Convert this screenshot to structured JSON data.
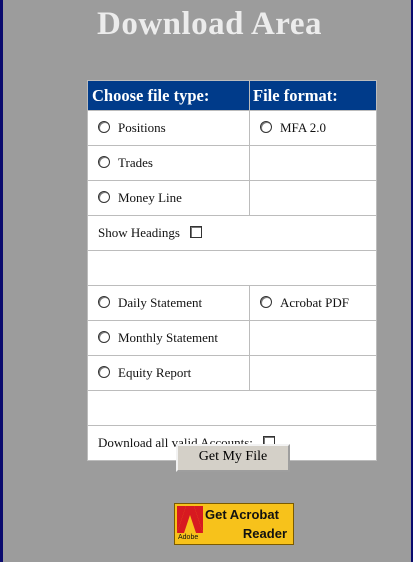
{
  "page": {
    "title": "Download Area"
  },
  "table": {
    "header_type": "Choose file type:",
    "header_format": "File format:",
    "group1": {
      "types": [
        "Positions",
        "Trades",
        "Money Line"
      ],
      "formats": [
        "MFA 2.0"
      ]
    },
    "show_headings_label": "Show Headings",
    "group2": {
      "types": [
        "Daily Statement",
        "Monthly Statement",
        "Equity Report"
      ],
      "formats": [
        "Acrobat PDF"
      ]
    },
    "download_all_label": "Download all valid Accounts:"
  },
  "submit": {
    "label": "Get My File"
  },
  "acrobat_badge": {
    "line1": "Get Acrobat",
    "line2": "Reader",
    "brand": "Adobe",
    "icon": "adobe-logo-icon",
    "color": "#f7c21b"
  },
  "colors": {
    "header_bg": "#003b8a",
    "frame_bg": "#9c9c9c",
    "frame_border": "#0a0a6e"
  }
}
